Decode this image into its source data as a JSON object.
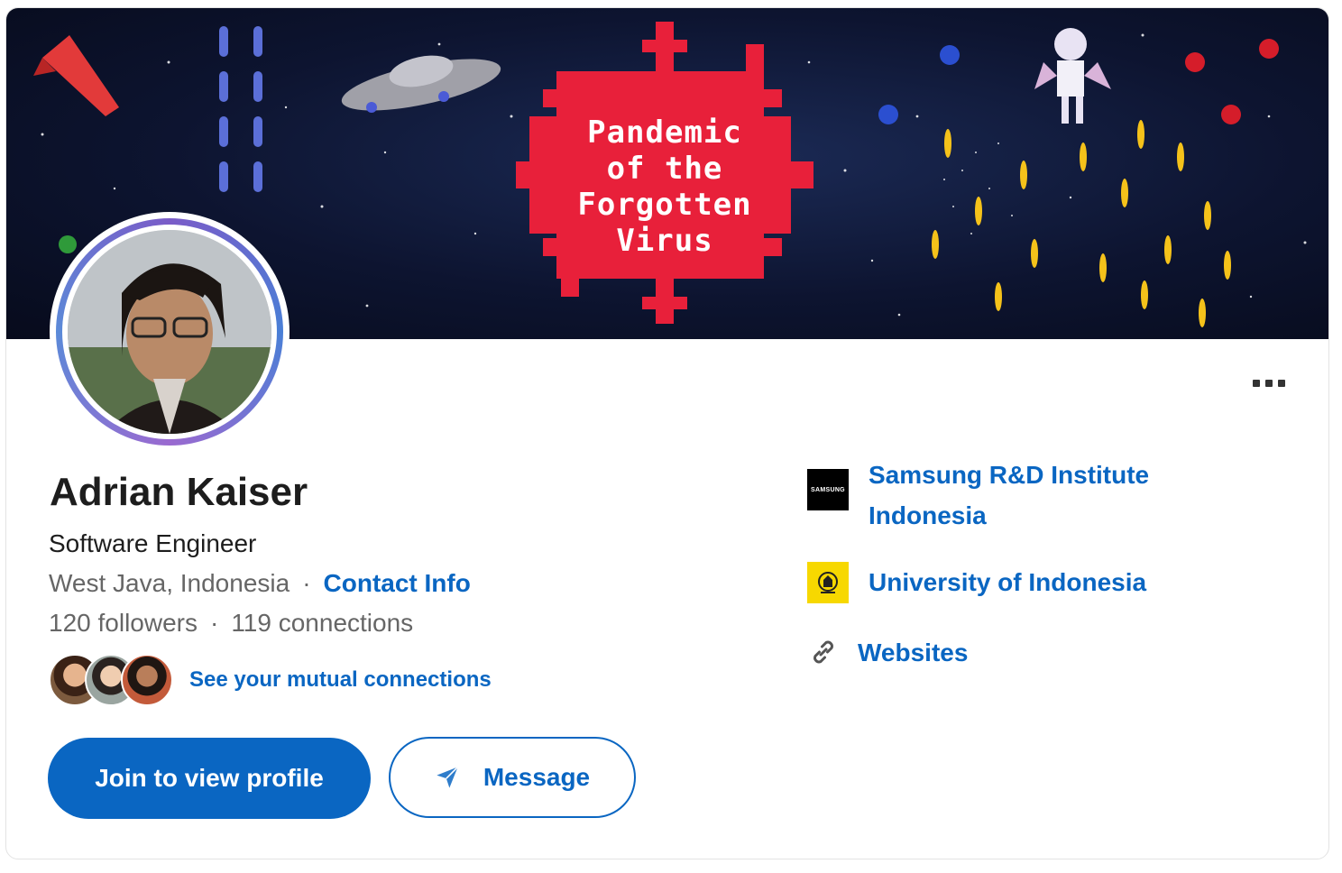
{
  "banner": {
    "title": "Pandemic\nof the\nForgotten\nVirus"
  },
  "profile": {
    "name": "Adrian Kaiser",
    "headline": "Software Engineer",
    "location": "West Java, Indonesia",
    "separator": "·",
    "contact_info_label": "Contact Info",
    "followers": "120 followers",
    "connections": "119 connections",
    "mutual_connections_label": "See your mutual connections"
  },
  "actions": {
    "join_label": "Join to view profile",
    "message_label": "Message",
    "more_icon": "more-horizontal-icon"
  },
  "sidebar": {
    "company": {
      "label": "Samsung R&D Institute Indonesia",
      "logo_text": "SAMSUNG",
      "logo_color": "#000000"
    },
    "school": {
      "label": "University of Indonesia",
      "logo_color": "#f7d800"
    },
    "websites": {
      "label": "Websites",
      "icon": "link-icon"
    }
  },
  "colors": {
    "accent": "#0a66c2",
    "virus_red": "#e8203a"
  }
}
